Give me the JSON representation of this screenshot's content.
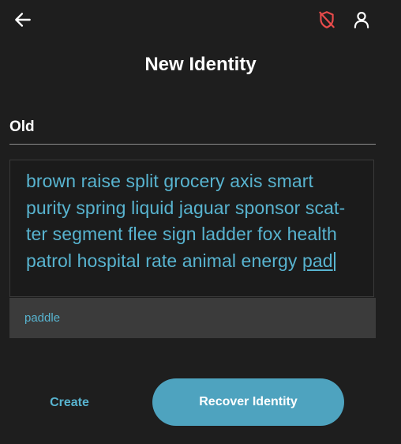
{
  "header": {
    "title": "New Identity",
    "back_icon": "arrow-left-icon",
    "shield_icon": "shield-off-icon",
    "profile_icon": "person-icon",
    "shield_color": "#e84b4b"
  },
  "tabs": {
    "active_label": "Old"
  },
  "phrase": {
    "lines": [
      "brown raise split grocery axis smart",
      "purity spring liquid jaguar sponsor scat-",
      "ter segment flee sign ladder fox health"
    ],
    "last_line_prefix": "patrol hospital rate animal energy ",
    "current_word": "pad",
    "text_color": "#58b4d0"
  },
  "suggestions": [
    "paddle"
  ],
  "actions": {
    "create_label": "Create",
    "recover_label": "Recover Identity",
    "accent_color": "#4ea3bf"
  }
}
